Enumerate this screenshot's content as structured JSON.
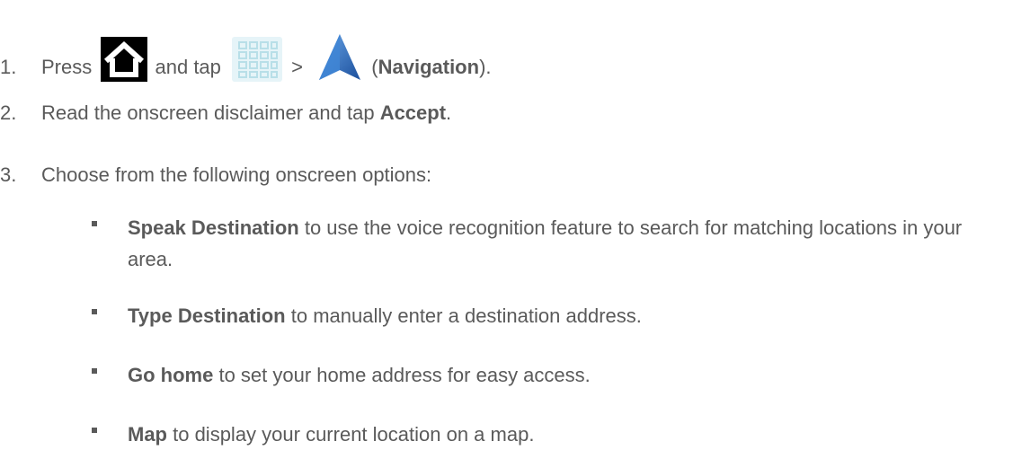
{
  "steps": [
    {
      "number": "1.",
      "parts": {
        "press": "Press",
        "and_tap": "and tap",
        "gt": ">",
        "open_paren": "(",
        "app_name": "Navigation",
        "close_paren": ")."
      }
    },
    {
      "number": "2.",
      "parts": {
        "text_before": "Read the onscreen disclaimer and tap",
        "bold": "Accept",
        "text_after": "."
      }
    },
    {
      "number": "3.",
      "parts": {
        "text": "Choose from the following onscreen options:"
      }
    }
  ],
  "options": [
    {
      "bold": "Speak Destination",
      "text": " to use the voice recognition feature to search for matching locations in your area."
    },
    {
      "bold": "Type Destination",
      "text": " to manually enter a destination address."
    },
    {
      "bold": "Go home",
      "text": " to set your home address for easy access."
    },
    {
      "bold": "Map",
      "text": " to display your current location on a map."
    }
  ],
  "icons": {
    "home": "home-icon",
    "apps": "apps-grid-icon",
    "navigation": "navigation-arrow-icon"
  },
  "colors": {
    "text": "#5a5a5a",
    "nav_blue": "#2a6fc4"
  }
}
